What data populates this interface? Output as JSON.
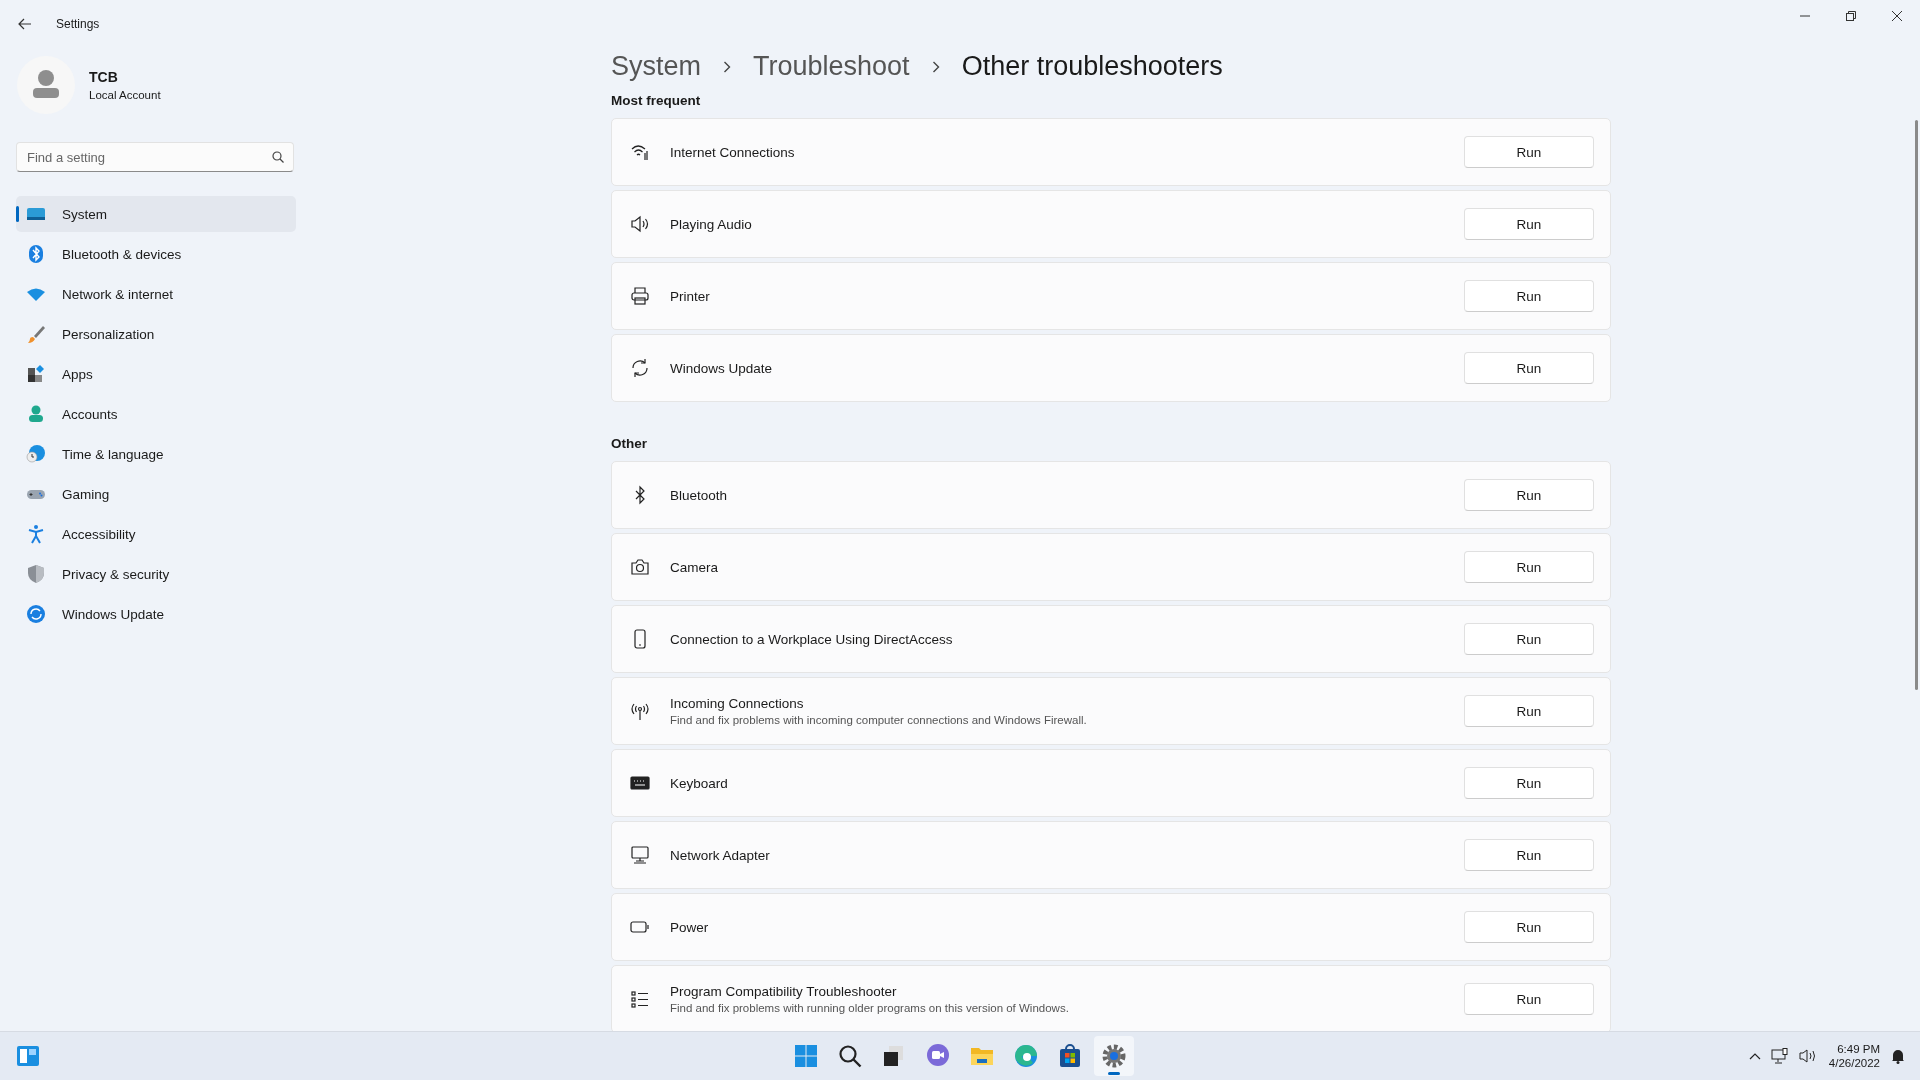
{
  "window": {
    "title": "Settings"
  },
  "profile": {
    "name": "TCB",
    "account": "Local Account"
  },
  "search": {
    "placeholder": "Find a setting"
  },
  "sidebar": {
    "items": [
      {
        "label": "System",
        "selected": true
      },
      {
        "label": "Bluetooth & devices",
        "selected": false
      },
      {
        "label": "Network & internet",
        "selected": false
      },
      {
        "label": "Personalization",
        "selected": false
      },
      {
        "label": "Apps",
        "selected": false
      },
      {
        "label": "Accounts",
        "selected": false
      },
      {
        "label": "Time & language",
        "selected": false
      },
      {
        "label": "Gaming",
        "selected": false
      },
      {
        "label": "Accessibility",
        "selected": false
      },
      {
        "label": "Privacy & security",
        "selected": false
      },
      {
        "label": "Windows Update",
        "selected": false
      }
    ]
  },
  "breadcrumb": [
    "System",
    "Troubleshoot",
    "Other troubleshooters"
  ],
  "sections": [
    {
      "title": "Most frequent",
      "items": [
        {
          "title": "Internet Connections",
          "button": "Run"
        },
        {
          "title": "Playing Audio",
          "button": "Run"
        },
        {
          "title": "Printer",
          "button": "Run"
        },
        {
          "title": "Windows Update",
          "button": "Run"
        }
      ]
    },
    {
      "title": "Other",
      "items": [
        {
          "title": "Bluetooth",
          "button": "Run"
        },
        {
          "title": "Camera",
          "button": "Run"
        },
        {
          "title": "Connection to a Workplace Using DirectAccess",
          "button": "Run"
        },
        {
          "title": "Incoming Connections",
          "description": "Find and fix problems with incoming computer connections and Windows Firewall.",
          "button": "Run"
        },
        {
          "title": "Keyboard",
          "button": "Run"
        },
        {
          "title": "Network Adapter",
          "button": "Run"
        },
        {
          "title": "Power",
          "button": "Run"
        },
        {
          "title": "Program Compatibility Troubleshooter",
          "description": "Find and fix problems with running older programs on this version of Windows.",
          "button": "Run"
        }
      ]
    }
  ],
  "taskbar": {
    "apps": [
      {
        "selected": false
      },
      {
        "selected": false
      },
      {
        "selected": false
      },
      {
        "selected": false
      },
      {
        "selected": false
      },
      {
        "selected": false
      },
      {
        "selected": false
      },
      {
        "selected": true
      }
    ],
    "time": "6:49 PM",
    "date": "4/26/2022"
  }
}
